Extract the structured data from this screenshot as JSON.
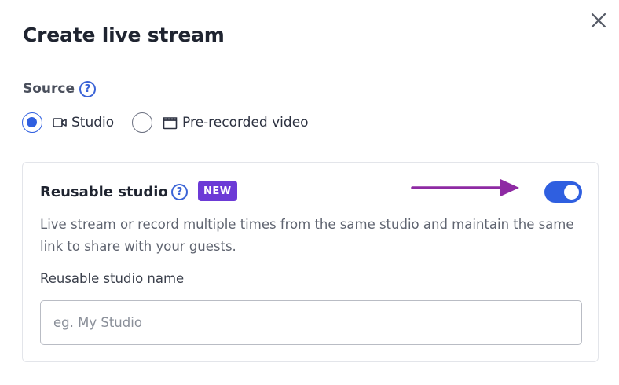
{
  "dialog": {
    "title": "Create live stream",
    "close_icon": "close-icon"
  },
  "source": {
    "label": "Source",
    "help_icon": "question-circle-icon",
    "help_glyph": "?",
    "options": [
      {
        "label": "Studio",
        "icon": "video-camera-icon",
        "selected": true
      },
      {
        "label": "Pre-recorded video",
        "icon": "film-clapper-icon",
        "selected": false
      }
    ]
  },
  "reusable": {
    "title": "Reusable studio",
    "help_glyph": "?",
    "badge": "NEW",
    "toggle_on": true,
    "description": "Live stream or record multiple times from the same studio and maintain the same link to share with your guests.",
    "name_label": "Reusable studio name",
    "name_placeholder": "eg. My Studio",
    "name_value": ""
  },
  "colors": {
    "accent": "#2f5fe0",
    "badge": "#6c3ad6",
    "annotation_arrow": "#8e2aa3"
  }
}
